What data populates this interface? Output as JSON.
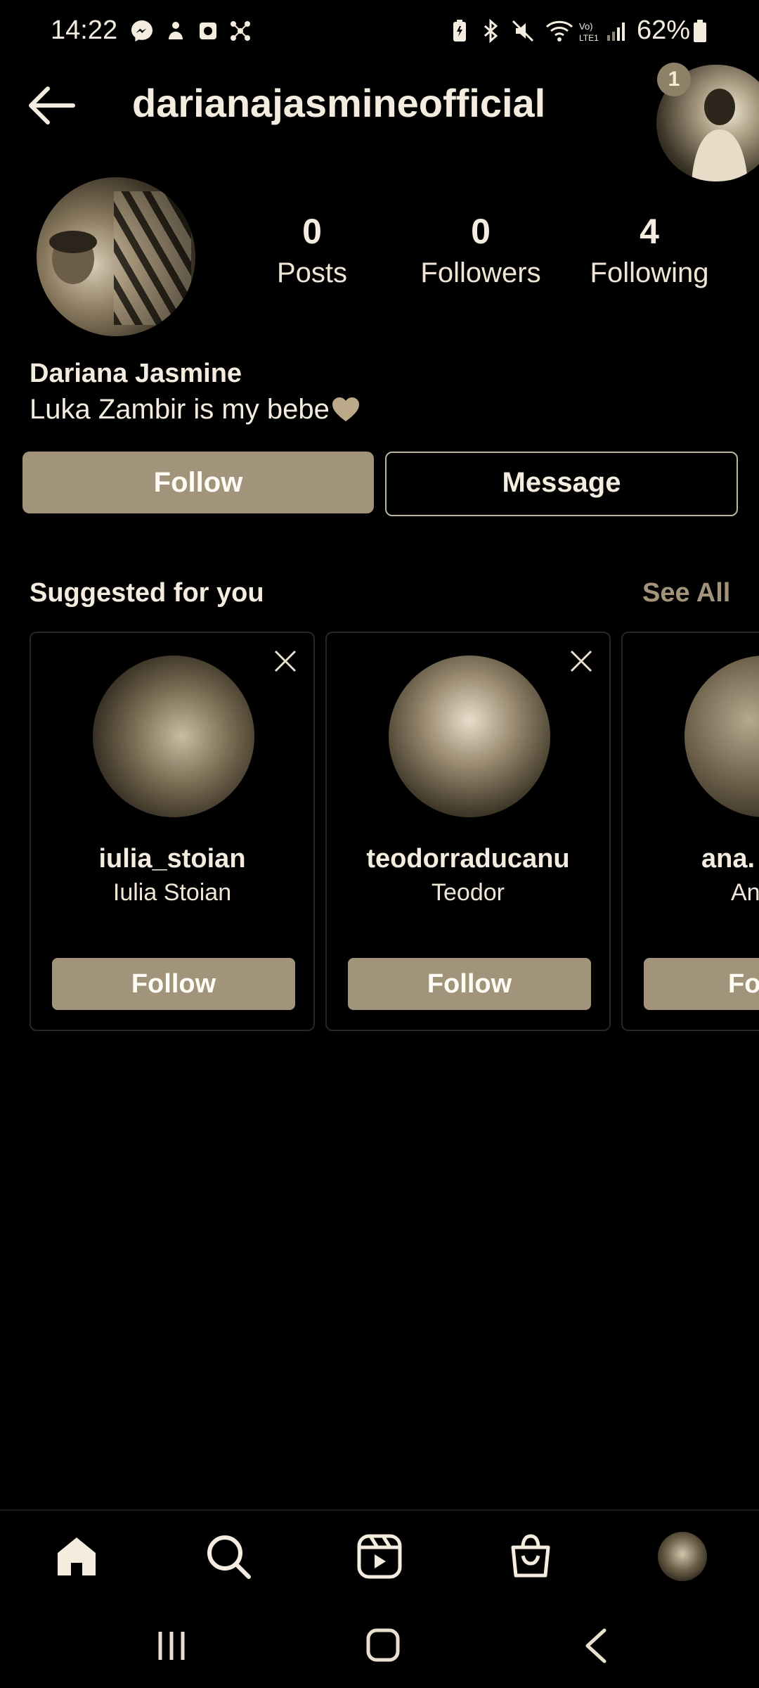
{
  "status_bar": {
    "time": "14:22",
    "battery": "62%",
    "icons": [
      "messenger-icon",
      "notification-icon",
      "app-icon",
      "network-icon",
      "battery-saver-icon",
      "bluetooth-icon",
      "mute-icon",
      "wifi-icon",
      "lte-signal-icon"
    ]
  },
  "header": {
    "username": "darianajasmineofficial",
    "story_badge_count": "1"
  },
  "profile": {
    "stats": [
      {
        "value": "0",
        "label": "Posts"
      },
      {
        "value": "0",
        "label": "Followers"
      },
      {
        "value": "4",
        "label": "Following"
      }
    ],
    "full_name": "Dariana Jasmine",
    "bio": "Luka Zambir is my bebe",
    "actions": {
      "follow": "Follow",
      "message": "Message"
    }
  },
  "suggestions": {
    "title": "Suggested for you",
    "see_all": "See All",
    "cards": [
      {
        "handle": "iulia_stoian",
        "name": "Iulia Stoian",
        "button": "Follow"
      },
      {
        "handle": "teodorraducanu",
        "name": "Teodor",
        "button": "Follow"
      },
      {
        "handle": "ana.",
        "name": "An",
        "button": "Fo"
      }
    ]
  },
  "bottom_nav": [
    "home-icon",
    "search-icon",
    "reels-icon",
    "shop-icon",
    "profile-avatar"
  ],
  "colors": {
    "accent": "#a2947a",
    "background": "#000000",
    "text": "#f3ecdf"
  }
}
